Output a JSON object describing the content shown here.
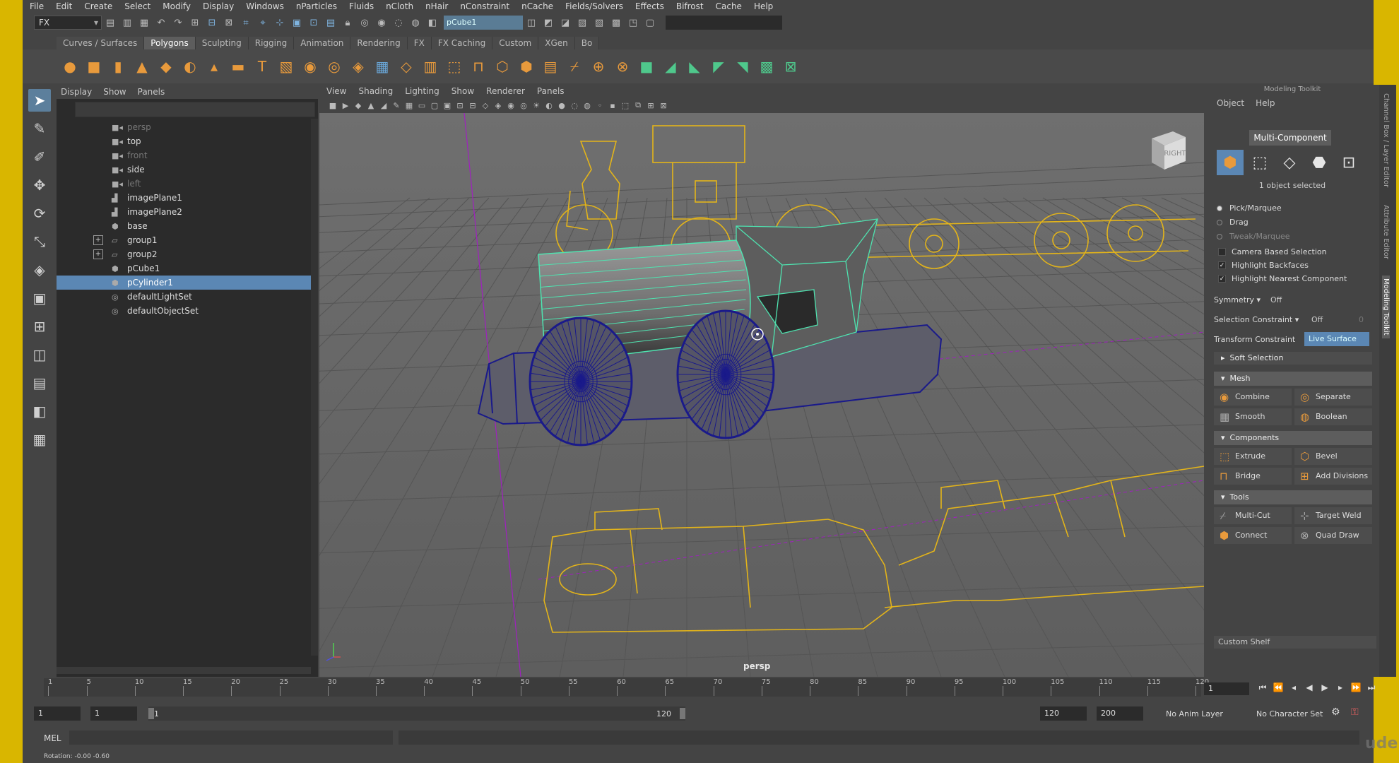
{
  "menubar": [
    "File",
    "Edit",
    "Create",
    "Select",
    "Modify",
    "Display",
    "Windows",
    "nParticles",
    "Fluids",
    "nCloth",
    "nHair",
    "nConstraint",
    "nCache",
    "Fields/Solvers",
    "Effects",
    "Bifrost",
    "Cache",
    "Help"
  ],
  "status": {
    "mode": "FX",
    "object_name": "pCube1"
  },
  "shelf_tabs": [
    "Curves / Surfaces",
    "Polygons",
    "Sculpting",
    "Rigging",
    "Animation",
    "Rendering",
    "FX",
    "FX Caching",
    "Custom",
    "XGen",
    "Bo"
  ],
  "shelf_active": "Polygons",
  "outliner": {
    "menu": [
      "Display",
      "Show",
      "Panels"
    ],
    "items": [
      {
        "label": "persp",
        "icon": "camera-icon",
        "state": "dim"
      },
      {
        "label": "top",
        "icon": "camera-icon",
        "state": ""
      },
      {
        "label": "front",
        "icon": "camera-icon",
        "state": "dim"
      },
      {
        "label": "side",
        "icon": "camera-icon",
        "state": ""
      },
      {
        "label": "left",
        "icon": "camera-icon",
        "state": "dim"
      },
      {
        "label": "imagePlane1",
        "icon": "image-plane-icon",
        "state": ""
      },
      {
        "label": "imagePlane2",
        "icon": "image-plane-icon",
        "state": ""
      },
      {
        "label": "base",
        "icon": "mesh-icon",
        "state": ""
      },
      {
        "label": "group1",
        "icon": "group-icon",
        "state": "",
        "expand": "+"
      },
      {
        "label": "group2",
        "icon": "group-icon",
        "state": "",
        "expand": "+"
      },
      {
        "label": "pCube1",
        "icon": "mesh-icon",
        "state": ""
      },
      {
        "label": "pCylinder1",
        "icon": "mesh-icon",
        "state": "selected"
      },
      {
        "label": "defaultLightSet",
        "icon": "set-icon",
        "state": ""
      },
      {
        "label": "defaultObjectSet",
        "icon": "set-icon",
        "state": ""
      }
    ]
  },
  "viewport": {
    "menu": [
      "View",
      "Shading",
      "Lighting",
      "Show",
      "Renderer",
      "Panels"
    ],
    "camera": "persp",
    "viewcube_label": "RIGHT"
  },
  "toolkit": {
    "title": "Modeling Toolkit",
    "menu": [
      "Object",
      "Help"
    ],
    "mode_button": "Multi-Component",
    "selection_status": "1 object selected",
    "pick_marquee": "Pick/Marquee",
    "drag": "Drag",
    "tweak_marquee": "Tweak/Marquee",
    "camera_based": "Camera Based Selection",
    "highlight_backfaces": "Highlight Backfaces",
    "highlight_nearest": "Highlight Nearest Component",
    "symmetry_label": "Symmetry",
    "symmetry_value": "Off",
    "selection_constraint_label": "Selection Constraint",
    "selection_constraint_value": "Off",
    "selection_constraint_num": "0",
    "transform_constraint_label": "Transform Constraint",
    "transform_constraint_value": "Live Surface",
    "soft_selection": "Soft Selection",
    "mesh_header": "Mesh",
    "combine": "Combine",
    "separate": "Separate",
    "smooth": "Smooth",
    "boolean": "Boolean",
    "components_header": "Components",
    "extrude": "Extrude",
    "bevel": "Bevel",
    "bridge": "Bridge",
    "add_divisions": "Add Divisions",
    "tools_header": "Tools",
    "multi_cut": "Multi-Cut",
    "target_weld": "Target Weld",
    "connect": "Connect",
    "quad_draw": "Quad Draw",
    "custom_shelf": "Custom Shelf"
  },
  "right_tabs": [
    "Channel Box / Layer Editor",
    "Attribute Editor",
    "Modeling Toolkit"
  ],
  "timeline": {
    "ticks": [
      "1",
      "5",
      "10",
      "15",
      "20",
      "25",
      "30",
      "35",
      "40",
      "45",
      "50",
      "55",
      "60",
      "65",
      "70",
      "75",
      "80",
      "85",
      "90",
      "95",
      "100",
      "105",
      "110",
      "115",
      "120"
    ],
    "current": "1"
  },
  "range": {
    "start": "1",
    "anim_start": "1",
    "slider_start": "1",
    "slider_end": "120",
    "end": "120",
    "anim_end": "200",
    "anim_layer": "No Anim Layer",
    "char_set": "No Character Set"
  },
  "cmd": {
    "label": "MEL"
  },
  "help": "Rotation:   -0.00      -0.60",
  "watermark": "udemy",
  "colors": {
    "accent": "#5b87b4",
    "frame": "#d9b600",
    "wire_selected": "#4fe3b0",
    "wire_blue": "#1a1a8a",
    "reference": "#e3b41a"
  }
}
